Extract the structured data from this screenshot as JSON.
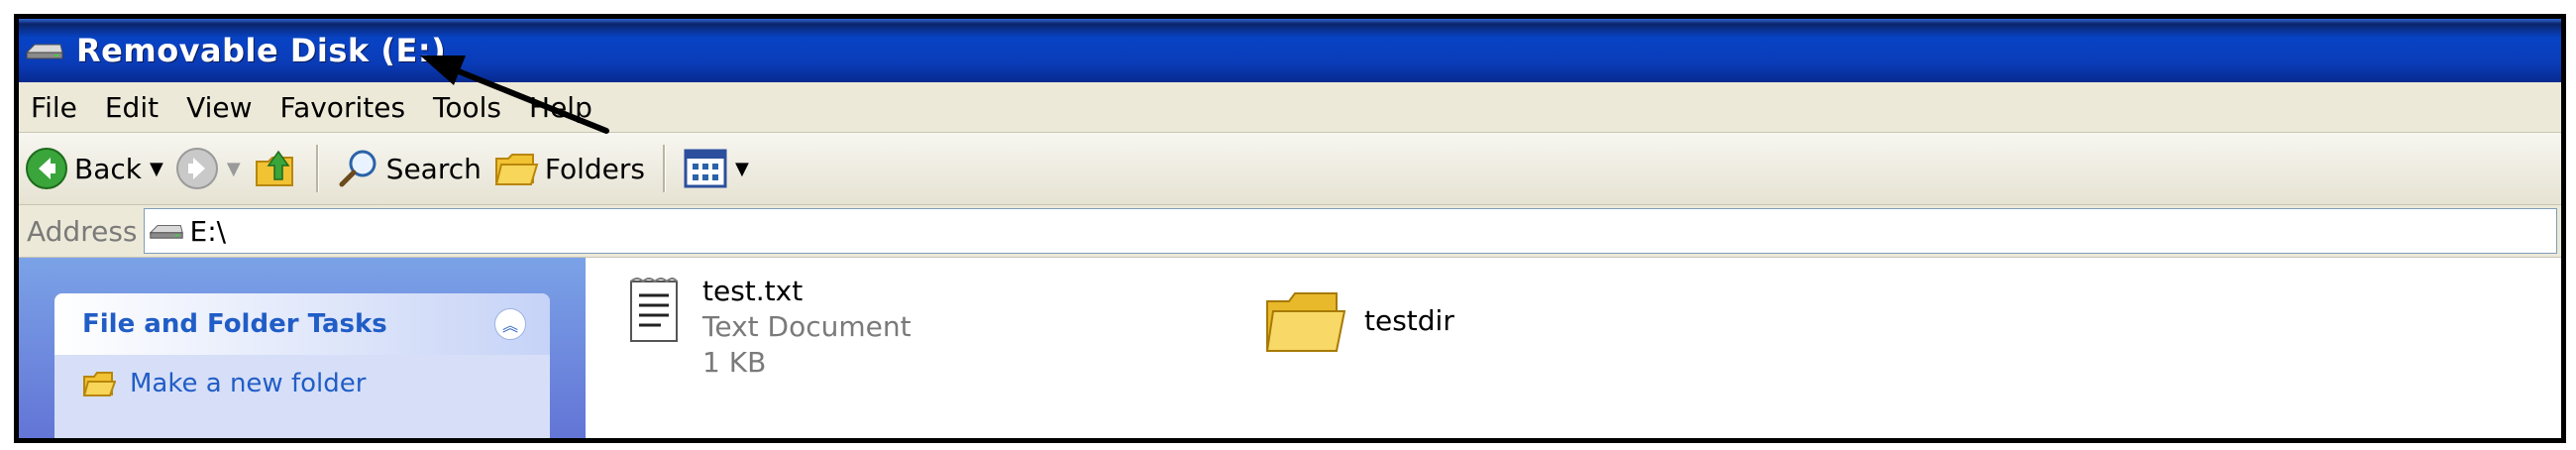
{
  "window": {
    "title": "Removable Disk (E:)"
  },
  "menu": {
    "items": [
      "File",
      "Edit",
      "View",
      "Favorites",
      "Tools",
      "Help"
    ]
  },
  "toolbar": {
    "back_label": "Back",
    "search_label": "Search",
    "folders_label": "Folders"
  },
  "address": {
    "label": "Address",
    "value": "E:\\"
  },
  "tasks": {
    "title": "File and Folder Tasks",
    "items": [
      {
        "label": "Make a new folder"
      }
    ]
  },
  "files": [
    {
      "name": "test.txt",
      "type": "Text Document",
      "size": "1 KB",
      "icon": "text-document-icon"
    },
    {
      "name": "testdir",
      "type": "",
      "size": "",
      "icon": "folder-icon"
    }
  ],
  "colors": {
    "titlebar": "#0843c5",
    "menubar": "#ece9d8",
    "task_pane": "#6375d6",
    "task_header_text": "#215dc6",
    "annotation_arrow": "#000000"
  }
}
